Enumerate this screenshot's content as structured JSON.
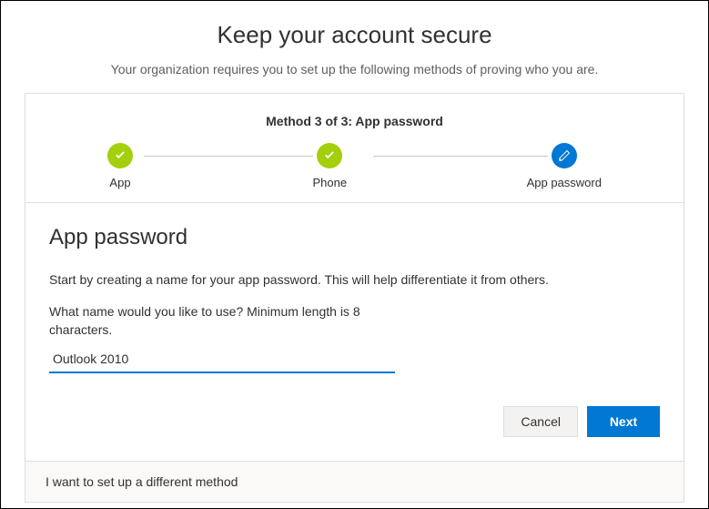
{
  "header": {
    "title": "Keep your account secure",
    "subtitle": "Your organization requires you to set up the following methods of proving who you are."
  },
  "progress": {
    "label": "Method 3 of 3: App password",
    "steps": [
      {
        "label": "App",
        "state": "complete"
      },
      {
        "label": "Phone",
        "state": "complete"
      },
      {
        "label": "App password",
        "state": "active"
      }
    ]
  },
  "form": {
    "section_title": "App password",
    "instruction": "Start by creating a name for your app password. This will help differentiate it from others.",
    "prompt": "What name would you like to use? Minimum length is 8 characters.",
    "value": "Outlook 2010"
  },
  "buttons": {
    "cancel": "Cancel",
    "next": "Next"
  },
  "footer": {
    "alt_method": "I want to set up a different method"
  }
}
